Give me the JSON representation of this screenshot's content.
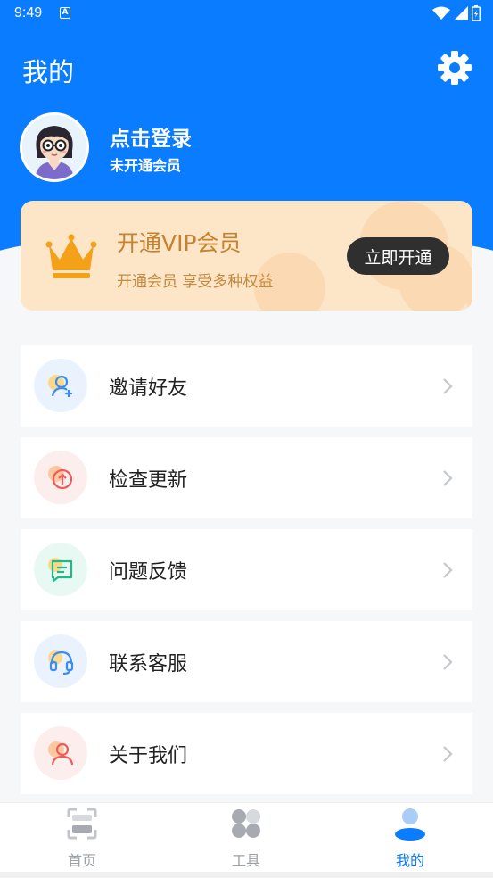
{
  "status_bar": {
    "time": "9:49"
  },
  "header": {
    "title": "我的"
  },
  "profile": {
    "login_text": "点击登录",
    "membership_status": "未开通会员"
  },
  "vip_card": {
    "title": "开通VIP会员",
    "subtitle": "开通会员 享受多种权益",
    "button_label": "立即开通"
  },
  "menu": {
    "items": [
      {
        "label": "邀请好友",
        "icon": "invite-user-icon"
      },
      {
        "label": "检查更新",
        "icon": "update-icon"
      },
      {
        "label": "问题反馈",
        "icon": "feedback-icon"
      },
      {
        "label": "联系客服",
        "icon": "headset-icon"
      },
      {
        "label": "关于我们",
        "icon": "about-user-icon"
      }
    ]
  },
  "tab_bar": {
    "tabs": [
      {
        "label": "首页",
        "icon": "scan-icon"
      },
      {
        "label": "工具",
        "icon": "grid-icon"
      },
      {
        "label": "我的",
        "icon": "user-icon",
        "active": true
      }
    ]
  },
  "colors": {
    "primary": "#0a7cff",
    "vip_background": "#fde5c8",
    "vip_text": "#c5822f",
    "vip_button": "#2f2f2f"
  }
}
